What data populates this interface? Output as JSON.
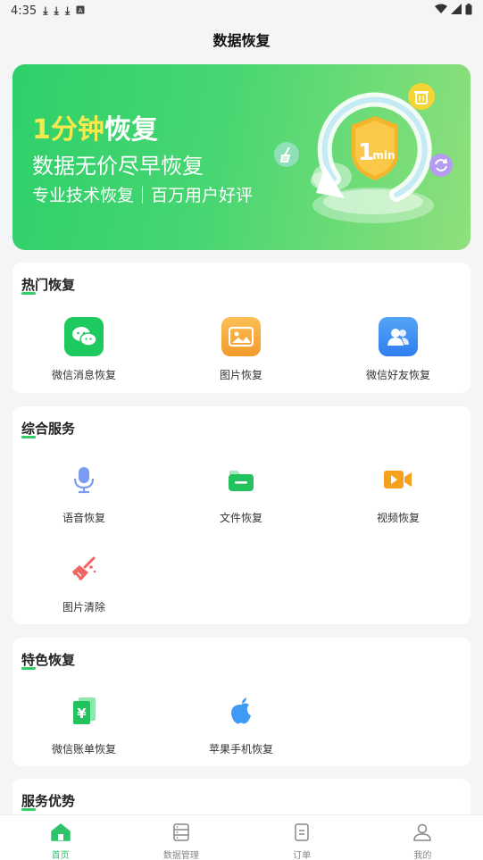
{
  "status_bar": {
    "time": "4:35"
  },
  "header": {
    "title": "数据恢复"
  },
  "banner": {
    "headline_highlight": "1分钟",
    "headline_rest": "恢复",
    "subtitle": "数据无价尽早恢复",
    "tagline": "专业技术恢复｜百万用户好评",
    "badge_number": "1",
    "badge_unit": "min"
  },
  "hot": {
    "title": "热门恢复",
    "items": [
      {
        "label": "微信消息恢复",
        "icon": "wechat-icon",
        "color": "#1ec95f"
      },
      {
        "label": "图片恢复",
        "icon": "image-icon",
        "color": "#f7a33a"
      },
      {
        "label": "微信好友恢复",
        "icon": "contacts-icon",
        "color": "#3f8cf5"
      }
    ]
  },
  "services": {
    "title": "综合服务",
    "items": [
      {
        "label": "语音恢复",
        "icon": "microphone-icon",
        "color": "#6a8ef0"
      },
      {
        "label": "文件恢复",
        "icon": "folder-icon",
        "color": "#26c560"
      },
      {
        "label": "视频恢复",
        "icon": "video-icon",
        "color": "#f5a11b"
      },
      {
        "label": "图片清除",
        "icon": "broom-icon",
        "color": "#f26464"
      }
    ]
  },
  "special": {
    "title": "特色恢复",
    "items": [
      {
        "label": "微信账单恢复",
        "icon": "bill-icon",
        "color": "#22c35e"
      },
      {
        "label": "苹果手机恢复",
        "icon": "apple-icon",
        "color": "#3e9af5"
      }
    ]
  },
  "advantages": {
    "title": "服务优势"
  },
  "tabbar": {
    "tabs": [
      {
        "label": "首页",
        "icon": "home-icon"
      },
      {
        "label": "数据管理",
        "icon": "data-icon"
      },
      {
        "label": "订单",
        "icon": "order-icon"
      },
      {
        "label": "我的",
        "icon": "user-icon"
      }
    ]
  }
}
